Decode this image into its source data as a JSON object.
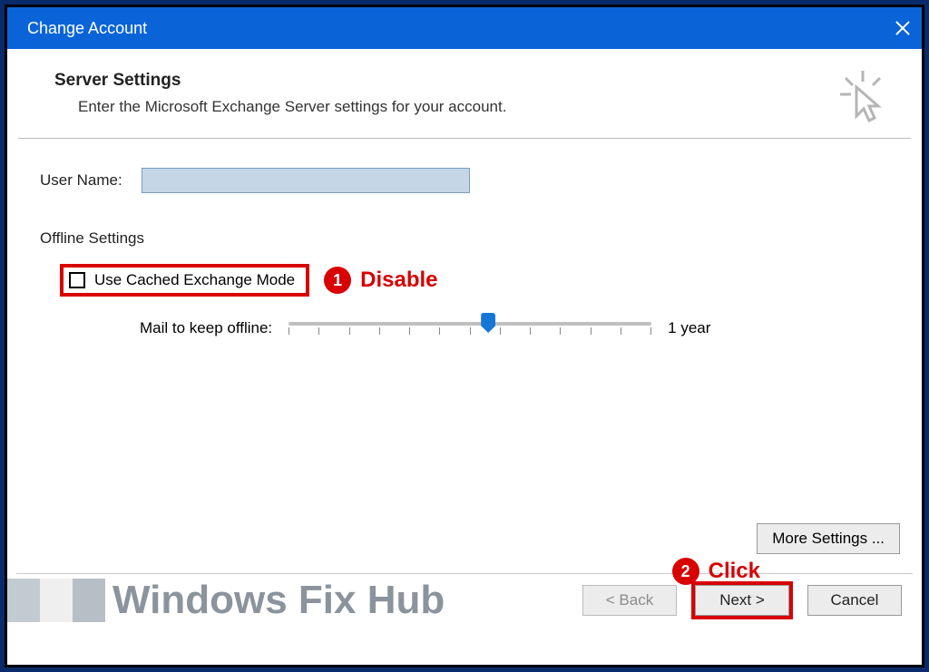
{
  "titlebar": {
    "title": "Change Account"
  },
  "header": {
    "title": "Server Settings",
    "subtitle": "Enter the Microsoft Exchange Server settings for your account."
  },
  "form": {
    "user_label": "User Name:",
    "user_value": "",
    "offline_section": "Offline Settings",
    "cached_label": "Use Cached Exchange Mode",
    "cached_checked": false,
    "slider_label": "Mail to keep offline:",
    "slider_value_label": "1 year"
  },
  "buttons": {
    "more": "More Settings ...",
    "back": "< Back",
    "next": "Next >",
    "cancel": "Cancel"
  },
  "annotations": {
    "a1_num": "1",
    "a1_text": "Disable",
    "a2_num": "2",
    "a2_text": "Click"
  },
  "watermark": "Windows Fix Hub"
}
